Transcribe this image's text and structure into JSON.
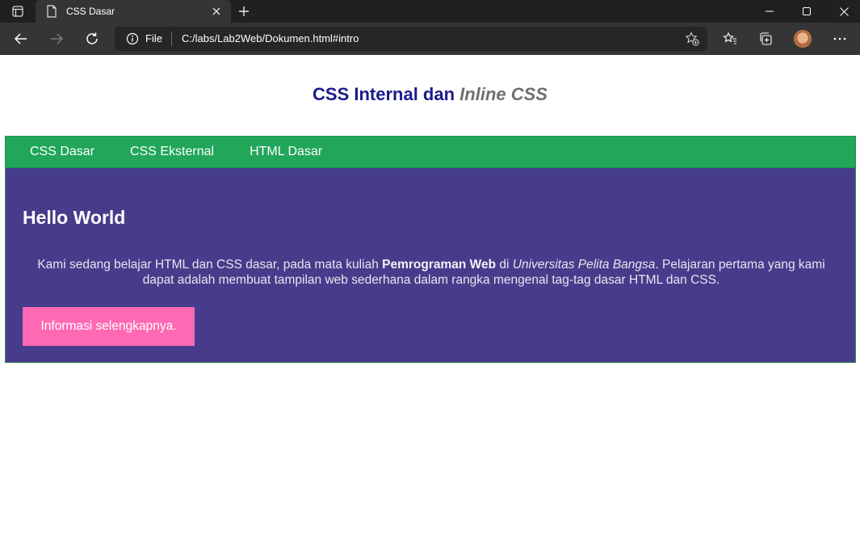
{
  "browser": {
    "tab_title": "CSS Dasar",
    "address_scheme": "File",
    "address_url": "C:/labs/Lab2Web/Dokumen.html#intro"
  },
  "icons": {
    "tab_actions": "tab-actions-icon",
    "favicon": "page-icon",
    "close": "close-icon",
    "new_tab": "plus-icon",
    "back": "back-arrow-icon",
    "forward": "forward-arrow-icon",
    "refresh": "refresh-icon",
    "info": "info-icon",
    "add_favorite": "star-plus-icon",
    "favorites": "favorites-icon",
    "collections": "collections-icon",
    "profile": "profile-avatar",
    "more": "more-icon",
    "minimize": "minimize-icon",
    "maximize": "maximize-icon",
    "window_close": "window-close-icon"
  },
  "header": {
    "title_part1": "CSS Internal dan ",
    "title_part2": "Inline CSS"
  },
  "nav": {
    "items": [
      {
        "label": "CSS Dasar"
      },
      {
        "label": "CSS Eksternal"
      },
      {
        "label": "HTML Dasar"
      }
    ]
  },
  "intro": {
    "heading": "Hello World",
    "text_1": "Kami sedang belajar HTML dan CSS dasar, pada mata kuliah ",
    "text_bold": "Pemrograman Web",
    "text_2": " di ",
    "text_italic": "Universitas Pelita Bangsa",
    "text_3": ". Pelajaran pertama yang kami dapat adalah membuat tampilan web sederhana dalam rangka mengenal tag-tag dasar HTML dan CSS.",
    "button_label": "Informasi selengkapnya."
  },
  "colors": {
    "nav_bg": "#21a65a",
    "main_bg": "#473c8b",
    "button_bg": "#ff69b4",
    "title_color": "#1a1a8c"
  }
}
